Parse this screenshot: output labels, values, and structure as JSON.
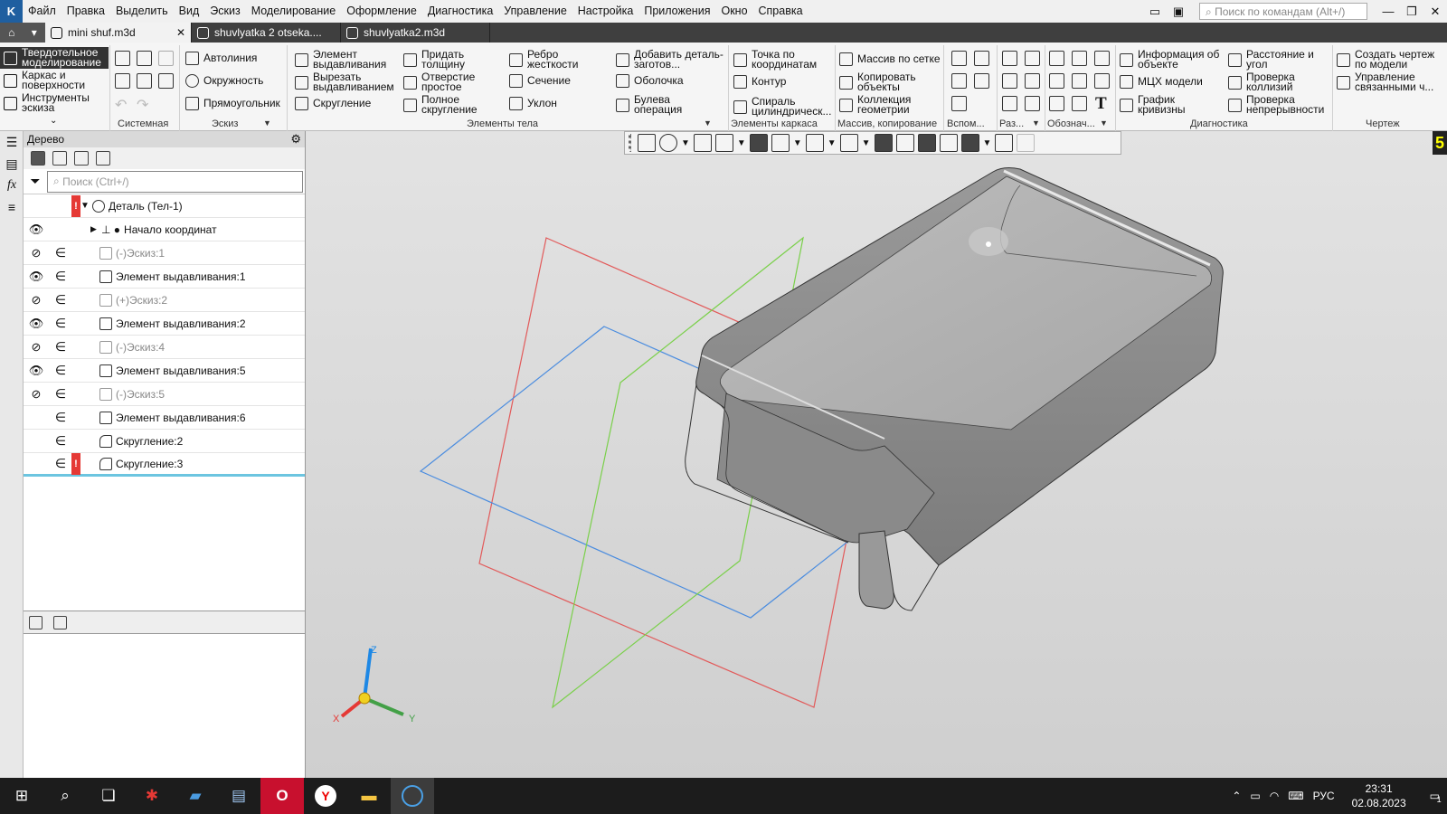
{
  "menubar": {
    "items": [
      "Файл",
      "Правка",
      "Выделить",
      "Вид",
      "Эскиз",
      "Моделирование",
      "Оформление",
      "Диагностика",
      "Управление",
      "Настройка",
      "Приложения",
      "Окно",
      "Справка"
    ],
    "search_placeholder": "Поиск по командам (Alt+/)"
  },
  "tabs": [
    {
      "label": "mini shuf.m3d",
      "active": true
    },
    {
      "label": "shuvlyatka 2 otseka....",
      "active": false
    },
    {
      "label": "shuvlyatka2.m3d",
      "active": false
    }
  ],
  "toolbar": {
    "modes": [
      "Твердотельное моделирование",
      "Каркас и поверхности",
      "Инструменты эскиза"
    ],
    "sketch": [
      "Автолиния",
      "Окружность",
      "Прямоугольник"
    ],
    "body1": [
      "Элемент выдавливания",
      "Вырезать выдавливанием",
      "Скругление"
    ],
    "body2": [
      "Придать толщину",
      "Отверстие простое",
      "Полное скругление"
    ],
    "body3": [
      "Ребро жесткости",
      "Сечение",
      "Уклон"
    ],
    "body4": [
      "Добавить деталь-заготов...",
      "Оболочка",
      "Булева операция"
    ],
    "frame": [
      "Точка по координатам",
      "Контур",
      "Спираль цилиндрическ..."
    ],
    "array": [
      "Массив по сетке",
      "Копировать объекты",
      "Коллекция геометрии"
    ],
    "diag1": [
      "Информация об объекте",
      "МЦХ модели",
      "График кривизны"
    ],
    "diag2": [
      "Расстояние и угол",
      "Проверка коллизий",
      "Проверка непрерывности"
    ],
    "drawing": [
      "Создать чертеж по модели",
      "Управление связанными ч..."
    ],
    "groups": [
      "Системная",
      "Эскиз",
      "Элементы тела",
      "Элементы каркаса",
      "Массив, копирование",
      "Вспом...",
      "Раз...",
      "Обознач...",
      "Диагностика",
      "Чертеж"
    ]
  },
  "tree": {
    "title": "Дерево",
    "search_placeholder": "Поиск (Ctrl+/)",
    "root": "Деталь (Тел-1)",
    "rows": [
      {
        "label": "Начало координат"
      },
      {
        "label": "(-)Эскиз:1"
      },
      {
        "label": "Элемент выдавливания:1"
      },
      {
        "label": "(+)Эскиз:2"
      },
      {
        "label": "Элемент выдавливания:2"
      },
      {
        "label": "(-)Эскиз:4"
      },
      {
        "label": "Элемент выдавливания:5"
      },
      {
        "label": "(-)Эскиз:5"
      },
      {
        "label": "Элемент выдавливания:6"
      },
      {
        "label": "Скругление:2"
      },
      {
        "label": "Скругление:3"
      }
    ]
  },
  "viewport": {
    "badge": "5",
    "axes": {
      "x": "X",
      "y": "Y",
      "z": "Z"
    },
    "colors": {
      "plane_xy": "#e25a5a",
      "plane_zx": "#4a8cdf",
      "plane_zy": "#7ad04a",
      "axis_x": "#e53935",
      "axis_y": "#43a047",
      "axis_z": "#1e88e5"
    }
  },
  "taskbar": {
    "time": "23:31",
    "date": "02.08.2023",
    "lang": "РУС",
    "notifications": "1"
  }
}
